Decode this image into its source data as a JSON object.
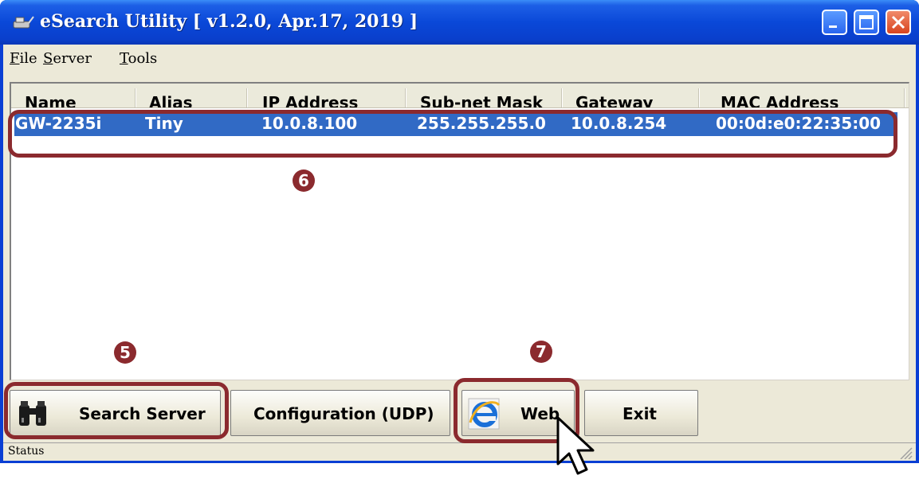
{
  "window": {
    "title": "eSearch Utility [ v1.2.0, Apr.17, 2019 ]"
  },
  "menu": [
    {
      "label": "File",
      "mnemonic": "F",
      "rest": "ile"
    },
    {
      "label": "Server",
      "mnemonic": "S",
      "rest": "erver"
    },
    {
      "label": "Tools",
      "mnemonic": "T",
      "rest": "ools"
    }
  ],
  "table": {
    "columns": [
      "Name",
      "Alias",
      "IP Address",
      "Sub-net Mask",
      "Gateway",
      "MAC Address"
    ],
    "rows": [
      [
        "GW-2235i",
        "Tiny",
        "10.0.8.100",
        "255.255.255.0",
        "10.0.8.254",
        "00:0d:e0:22:35:00"
      ]
    ],
    "selected_row": 0
  },
  "buttons": {
    "search": "Search Server",
    "config": "Configuration (UDP)",
    "web": "Web",
    "exit": "Exit"
  },
  "status": {
    "label": "Status"
  },
  "annotations": {
    "step5": "5",
    "step6": "6",
    "step7": "7"
  },
  "colors": {
    "selection": "#316ac5",
    "highlight": "#8b2a2e",
    "titlebar": "#0a48d8"
  },
  "icons": [
    "app-icon",
    "minimize-icon",
    "maximize-icon",
    "close-icon",
    "binoculars-icon",
    "ie-icon",
    "cursor-icon"
  ]
}
